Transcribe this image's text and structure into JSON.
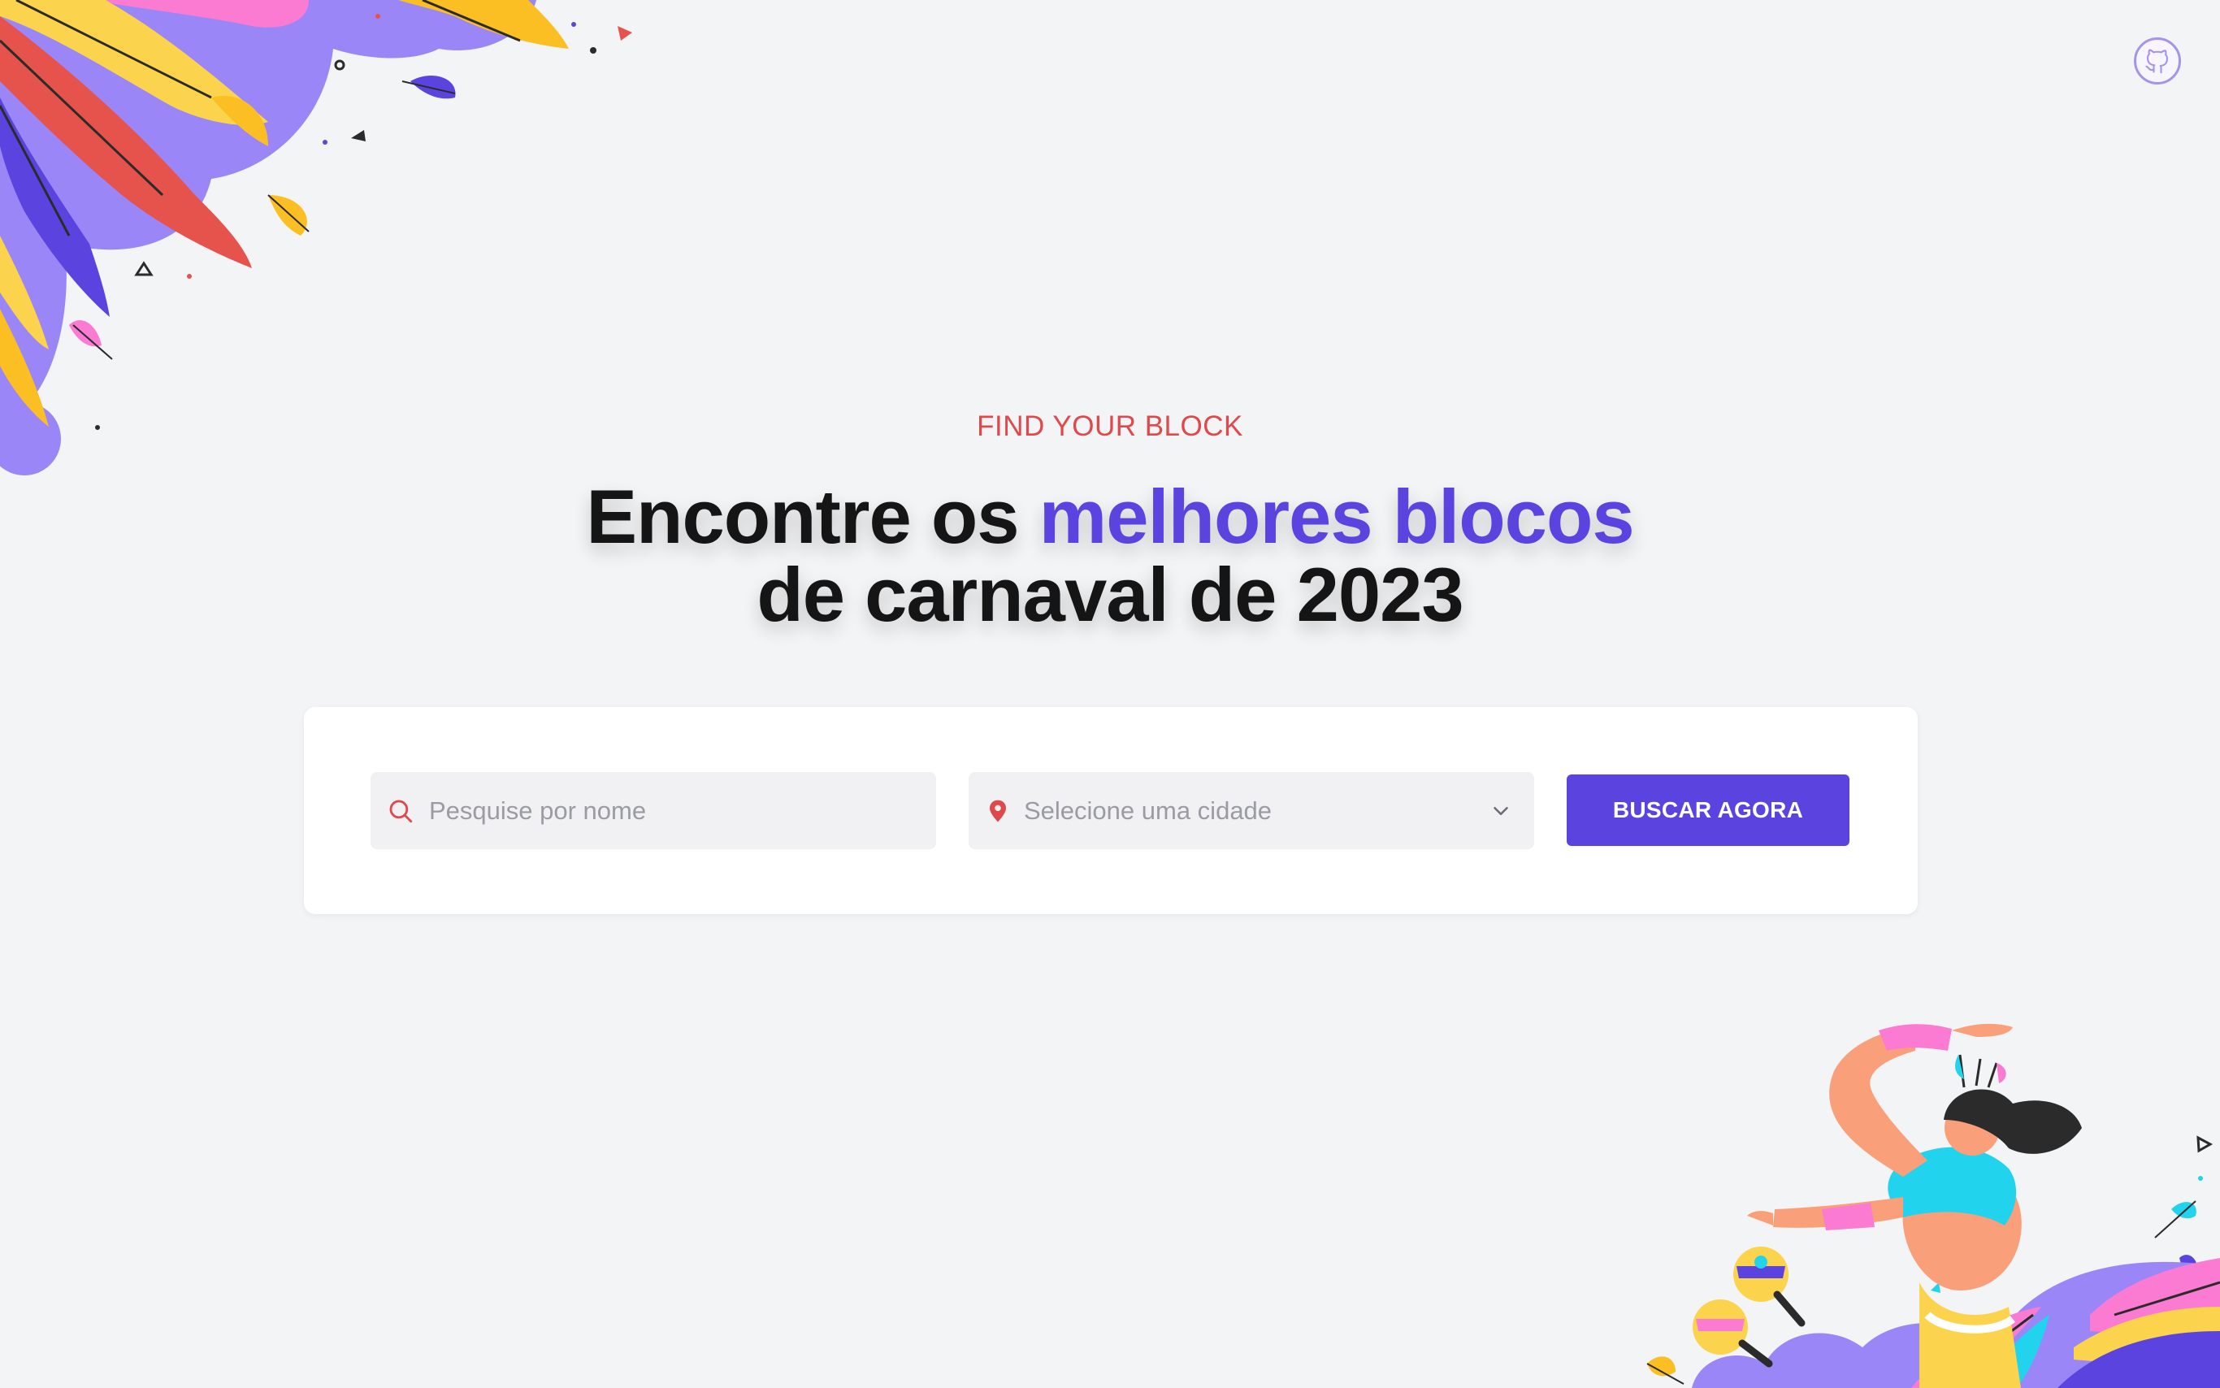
{
  "header": {
    "eyebrow": "FIND YOUR BLOCK",
    "headline_part1": "Encontre os ",
    "headline_accent": "melhores blocos",
    "headline_line2": "de carnaval de 2023"
  },
  "search": {
    "name_placeholder": "Pesquise por nome",
    "city_placeholder": "Selecione uma cidade",
    "submit_label": "BUSCAR AGORA"
  },
  "icons": {
    "github": "github-icon",
    "search": "search-icon",
    "location": "map-pin-icon",
    "chevron": "chevron-down-icon"
  },
  "colors": {
    "accent": "#5b43e0",
    "eyebrow": "#e0484b",
    "background": "#f3f4f6"
  }
}
